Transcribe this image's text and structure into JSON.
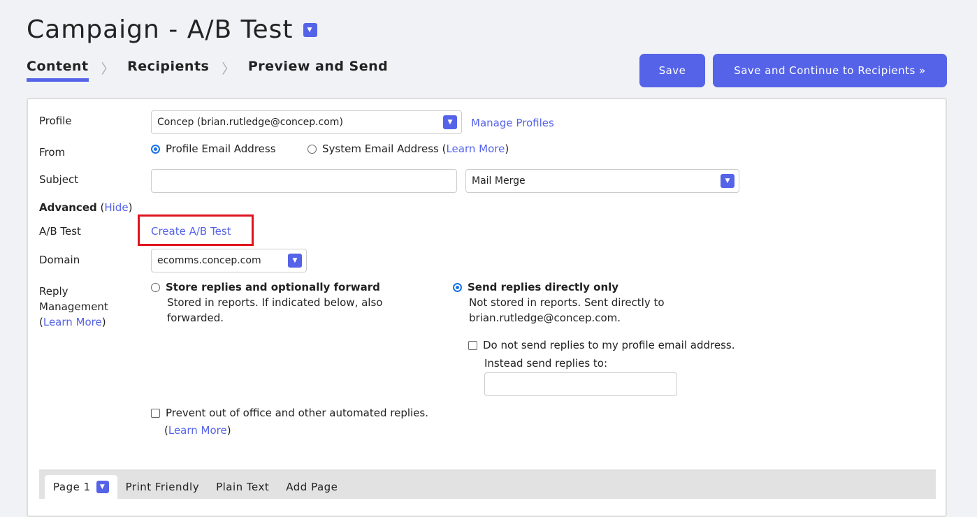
{
  "header": {
    "title": "Campaign - A/B Test",
    "steps": [
      "Content",
      "Recipients",
      "Preview and Send"
    ],
    "active_step": "Content"
  },
  "buttons": {
    "save": "Save",
    "save_continue": "Save and Continue to Recipients »"
  },
  "form": {
    "profile_label": "Profile",
    "profile_value": "Concep (brian.rutledge@concep.com)",
    "manage_profiles": "Manage Profiles",
    "from_label": "From",
    "from_opt1": "Profile Email Address",
    "from_opt2": "System Email Address",
    "learn_more": "Learn More",
    "from_selected": "Profile Email Address",
    "subject_label": "Subject",
    "subject_value": "",
    "mail_merge": "Mail Merge",
    "advanced_label": "Advanced",
    "hide": "Hide",
    "ab_label": "A/B Test",
    "ab_link": "Create A/B Test",
    "domain_label": "Domain",
    "domain_value": "ecomms.concep.com",
    "reply_label1": "Reply",
    "reply_label2": "Management",
    "reply_opt1_title": "Store replies and optionally forward",
    "reply_opt1_desc1": "Stored in reports. If indicated below, also",
    "reply_opt1_desc2": "forwarded.",
    "reply_opt2_title": "Send replies directly only",
    "reply_opt2_desc1": "Not stored in reports. Sent directly to",
    "reply_opt2_desc2": "brian.rutledge@concep.com.",
    "reply_selected": "Send replies directly only",
    "no_send_label": "Do not send replies to my profile email address.",
    "instead_label": "Instead send replies to:",
    "instead_value": "",
    "prevent_label": "Prevent out of office and other automated replies."
  },
  "tabs": [
    "Page 1",
    "Print Friendly",
    "Plain Text",
    "Add Page"
  ],
  "colors": {
    "accent": "#5563e8",
    "highlight": "#e0141e"
  }
}
